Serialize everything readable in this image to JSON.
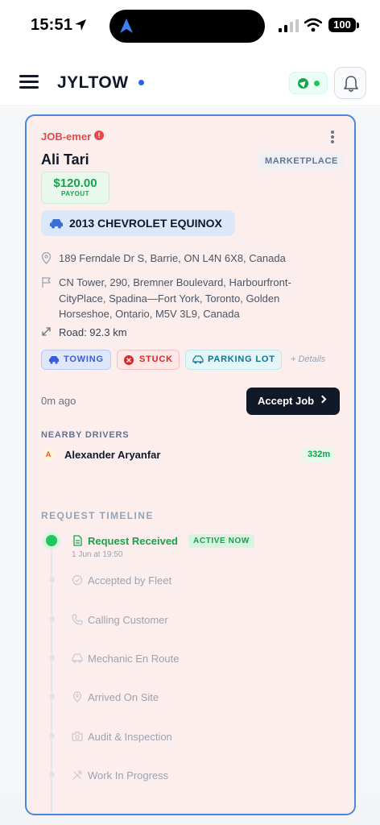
{
  "status_bar": {
    "time": "15:51",
    "battery": "100"
  },
  "header": {
    "brand": "JYLTOW"
  },
  "job": {
    "id": "JOB-emer",
    "customer": "Ali Tari",
    "badge": "MARKETPLACE",
    "payout_amount": "$120.00",
    "payout_label": "PAYOUT",
    "vehicle": "2013 CHEVROLET EQUINOX",
    "pickup": "189 Ferndale Dr S, Barrie, ON L4N 6X8, Canada",
    "dropoff": "CN Tower, 290, Bremner Boulevard, Harbourfront-CityPlace, Spadina—Fort York, Toronto, Golden Horseshoe, Ontario, M5V 3L9, Canada",
    "distance": "Road: 92.3 km",
    "tags": [
      "TOWING",
      "STUCK",
      "PARKING LOT"
    ],
    "details_link": "+ Details",
    "posted_ago": "0m ago",
    "accept_label": "Accept Job"
  },
  "nearby": {
    "heading": "NEARBY DRIVERS",
    "drivers": [
      {
        "initial": "A",
        "name": "Alexander Aryanfar",
        "distance": "332m"
      }
    ]
  },
  "timeline": {
    "heading": "REQUEST TIMELINE",
    "active_badge": "ACTIVE NOW",
    "active_time": "1 Jun at 19:50",
    "steps": [
      {
        "label": "Request Received",
        "icon": "document-icon"
      },
      {
        "label": "Accepted by Fleet",
        "icon": "check-circle-icon"
      },
      {
        "label": "Calling Customer",
        "icon": "phone-icon"
      },
      {
        "label": "Mechanic En Route",
        "icon": "car-icon"
      },
      {
        "label": "Arrived On Site",
        "icon": "pin-icon"
      },
      {
        "label": "Audit & Inspection",
        "icon": "camera-icon"
      },
      {
        "label": "Work In Progress",
        "icon": "tools-icon"
      }
    ]
  },
  "colors": {
    "accent_blue": "#2563eb",
    "card_border": "#4a86e0",
    "card_bg": "#fdeeee",
    "success": "#16a34a",
    "danger": "#e5484d"
  }
}
